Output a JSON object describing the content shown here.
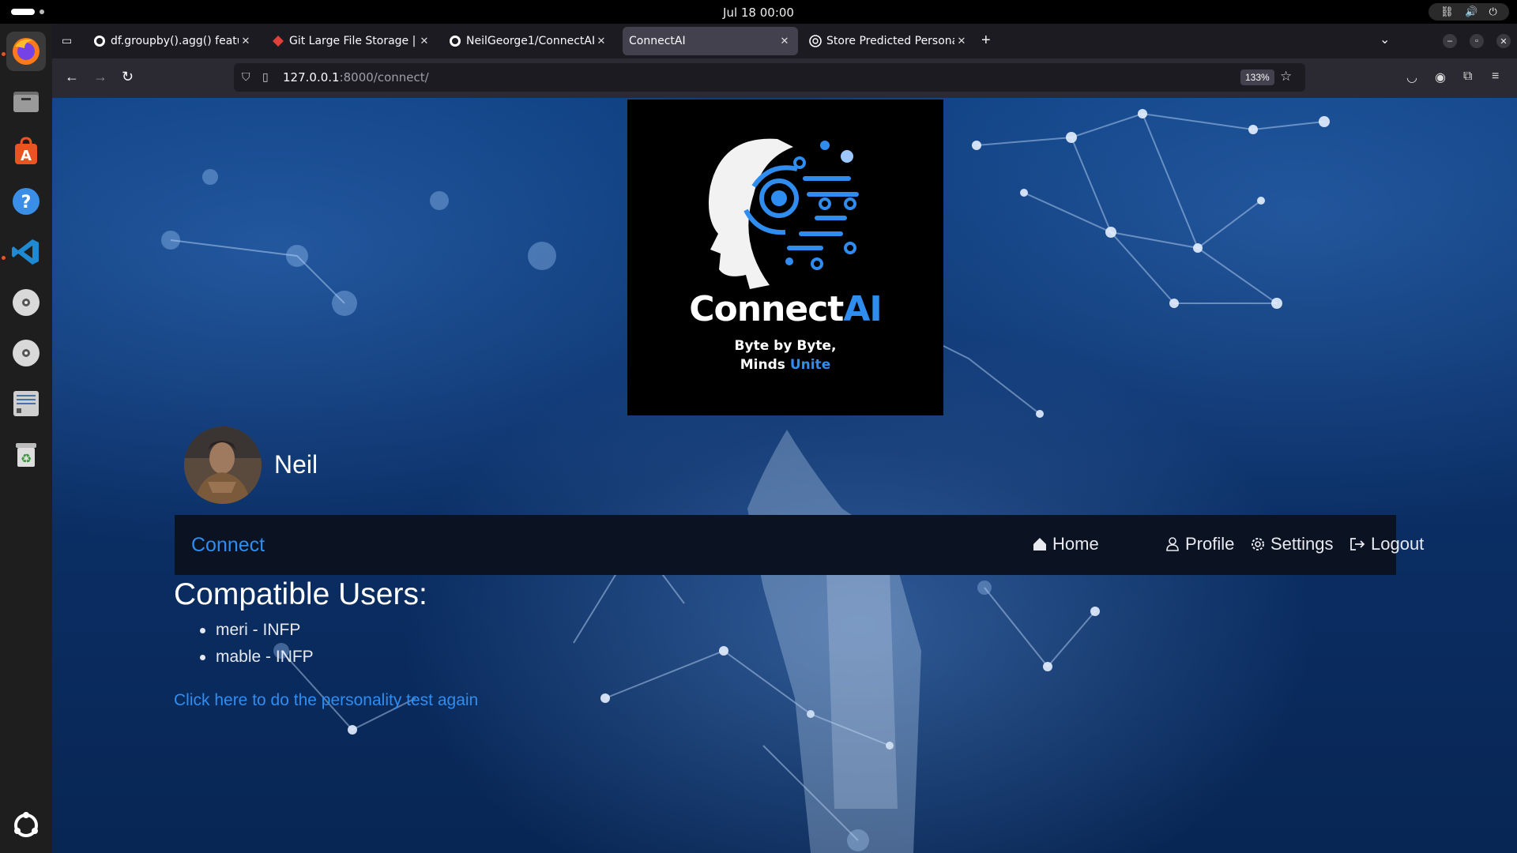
{
  "system": {
    "clock": "Jul 18  00:00"
  },
  "dock": {
    "items": [
      "firefox-icon",
      "files-icon",
      "app-center-icon",
      "help-icon",
      "vscode-icon",
      "disc-icon",
      "disc-icon",
      "text-editor-icon",
      "trash-icon",
      "show-apps-icon"
    ]
  },
  "browser": {
    "tabs": [
      {
        "title": "df.groupby().agg() featur",
        "icon": "github-icon",
        "active": false
      },
      {
        "title": "Git Large File Storage | Gi",
        "icon": "git-lfs-icon",
        "active": false
      },
      {
        "title": "NeilGeorge1/ConnectAI",
        "icon": "github-icon",
        "active": false
      },
      {
        "title": "ConnectAI",
        "icon": "",
        "active": true
      },
      {
        "title": "Store Predicted Personali",
        "icon": "chatgpt-icon",
        "active": false
      }
    ],
    "url_host": "127.0.0.1",
    "url_rest": ":8000/connect/",
    "zoom": "133%"
  },
  "page": {
    "logo": {
      "brand_main": "Connect",
      "brand_accent": "AI",
      "tagline_line1": "Byte by Byte,",
      "tagline_line2_main": "Minds",
      "tagline_line2_accent": "Unite"
    },
    "username": "Neil",
    "nav": {
      "brand": "Connect",
      "links": [
        "Home",
        "Profile",
        "Settings",
        "Logout"
      ]
    },
    "section_title": "Compatible Users:",
    "compatible_users": [
      "meri - INFP",
      "mable - INFP"
    ],
    "retake_link": "Click here to do the personality test again"
  },
  "colors": {
    "accent": "#2f8df0",
    "nav_bg": "#0b1222",
    "logo_bg": "#000000"
  }
}
